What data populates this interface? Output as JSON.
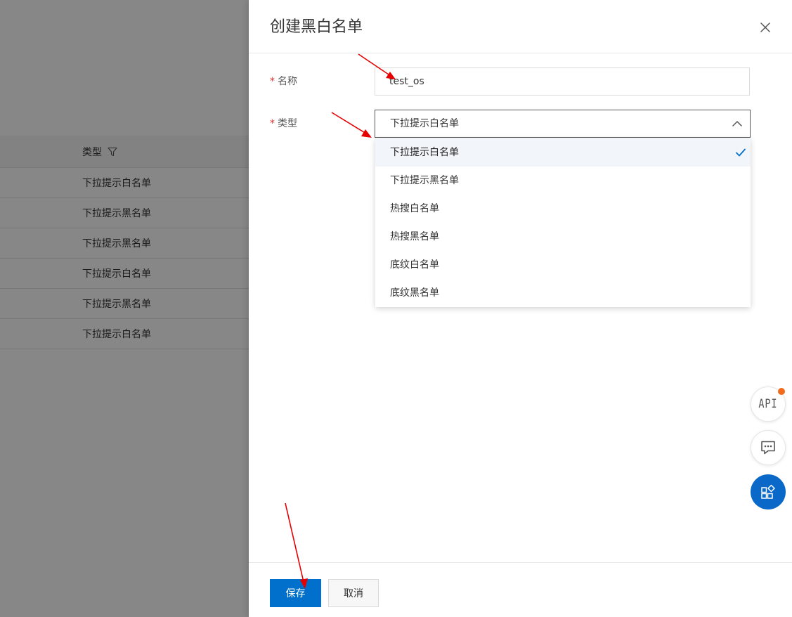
{
  "background": {
    "column_title": "类型",
    "filter_icon": "filter-icon",
    "rows": [
      "下拉提示白名单",
      "下拉提示黑名单",
      "下拉提示黑名单",
      "下拉提示白名单",
      "下拉提示黑名单",
      "下拉提示白名单"
    ]
  },
  "drawer": {
    "title": "创建黑白名单",
    "close_icon": "close-icon",
    "name_field": {
      "required_mark": "*",
      "label": "名称",
      "value": "test_os"
    },
    "type_field": {
      "required_mark": "*",
      "label": "类型",
      "selected": "下拉提示白名单",
      "options": [
        "下拉提示白名单",
        "下拉提示黑名单",
        "热搜白名单",
        "热搜黑名单",
        "底纹白名单",
        "底纹黑名单"
      ]
    },
    "footer": {
      "save_label": "保存",
      "cancel_label": "取消"
    }
  },
  "floating": {
    "api_label": "API",
    "chat_icon": "chat-icon",
    "apps_icon": "apps-icon"
  },
  "colors": {
    "primary": "#0070cc",
    "required": "#e3342f",
    "notification_dot": "#f26b1d",
    "annotation_arrow": "#e60000"
  }
}
